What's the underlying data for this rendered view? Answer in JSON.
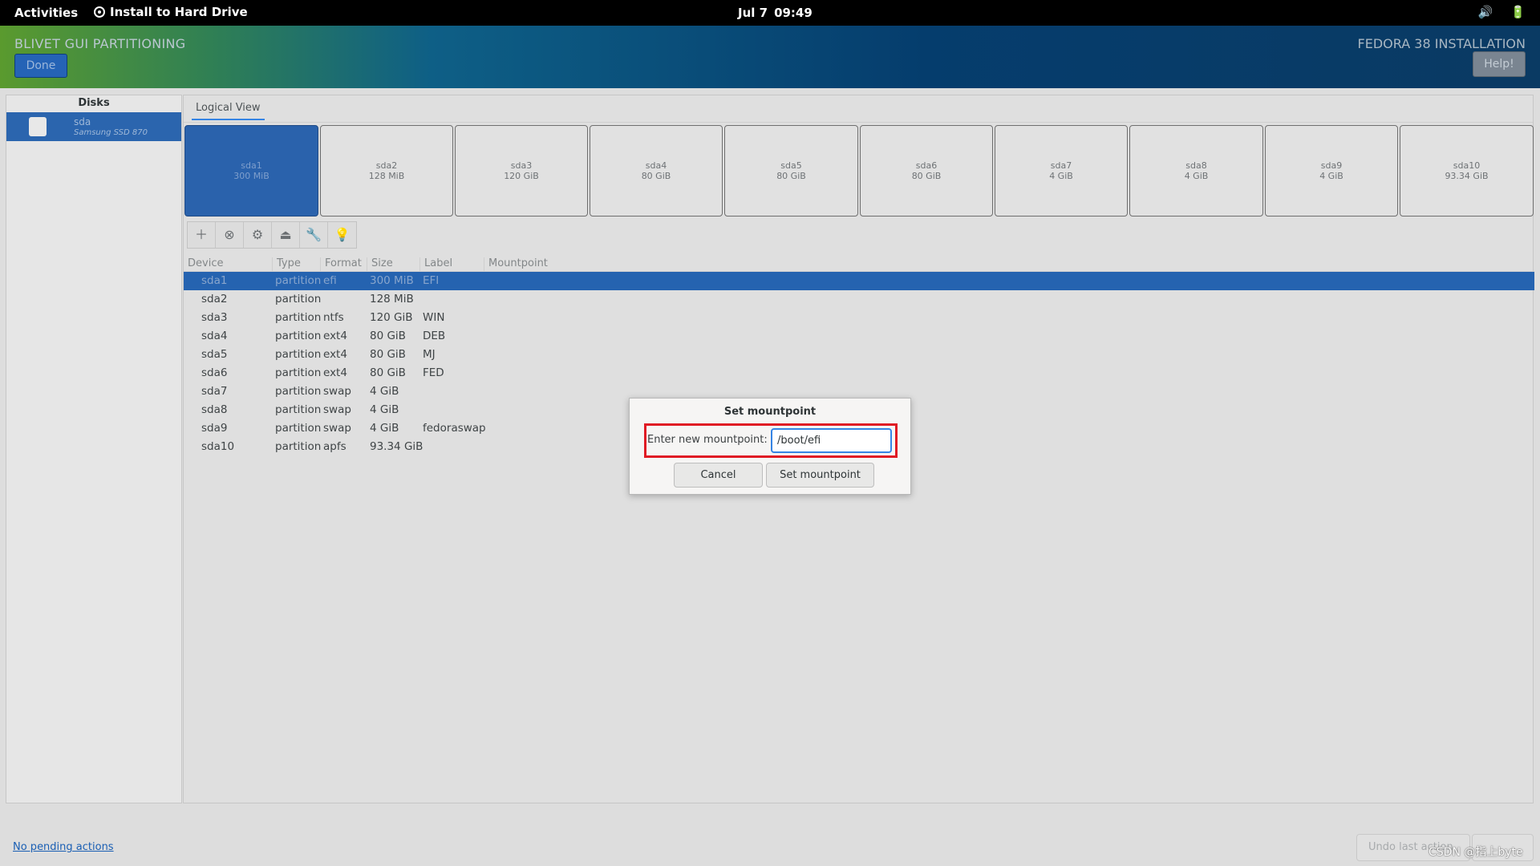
{
  "topbar": {
    "activities": "Activities",
    "app_name": "Install to Hard Drive",
    "date": "Jul 7",
    "time": "09:49",
    "icons": [
      "volume-icon",
      "battery-icon"
    ]
  },
  "header": {
    "spoke_title": "BLIVET GUI PARTITIONING",
    "done_label": "Done",
    "product_title": "FEDORA 38 INSTALLATION",
    "help_label": "Help!"
  },
  "disks": {
    "heading": "Disks",
    "items": [
      {
        "name": "sda",
        "model": "Samsung SSD 870"
      }
    ]
  },
  "logical_view": {
    "tab_label": "Logical View",
    "partitions": [
      {
        "name": "sda1",
        "size": "300 MiB",
        "selected": true
      },
      {
        "name": "sda2",
        "size": "128 MiB",
        "selected": false
      },
      {
        "name": "sda3",
        "size": "120 GiB",
        "selected": false
      },
      {
        "name": "sda4",
        "size": "80 GiB",
        "selected": false
      },
      {
        "name": "sda5",
        "size": "80 GiB",
        "selected": false
      },
      {
        "name": "sda6",
        "size": "80 GiB",
        "selected": false
      },
      {
        "name": "sda7",
        "size": "4 GiB",
        "selected": false
      },
      {
        "name": "sda8",
        "size": "4 GiB",
        "selected": false
      },
      {
        "name": "sda9",
        "size": "4 GiB",
        "selected": false
      },
      {
        "name": "sda10",
        "size": "93.34 GiB",
        "selected": false
      }
    ]
  },
  "toolbar": {
    "icons": [
      "add-icon",
      "delete-icon",
      "edit-icon",
      "unmount-icon",
      "settings-icon",
      "info-icon"
    ]
  },
  "table": {
    "columns": [
      "Device",
      "Type",
      "Format",
      "Size",
      "Label",
      "Mountpoint"
    ],
    "rows": [
      {
        "device": "sda1",
        "type": "partition",
        "format": "efi",
        "size": "300 MiB",
        "label": "EFI",
        "mountpoint": "",
        "selected": true
      },
      {
        "device": "sda2",
        "type": "partition",
        "format": "",
        "size": "128 MiB",
        "label": "",
        "mountpoint": "",
        "selected": false
      },
      {
        "device": "sda3",
        "type": "partition",
        "format": "ntfs",
        "size": "120 GiB",
        "label": "WIN",
        "mountpoint": "",
        "selected": false
      },
      {
        "device": "sda4",
        "type": "partition",
        "format": "ext4",
        "size": "80 GiB",
        "label": "DEB",
        "mountpoint": "",
        "selected": false
      },
      {
        "device": "sda5",
        "type": "partition",
        "format": "ext4",
        "size": "80 GiB",
        "label": "MJ",
        "mountpoint": "",
        "selected": false
      },
      {
        "device": "sda6",
        "type": "partition",
        "format": "ext4",
        "size": "80 GiB",
        "label": "FED",
        "mountpoint": "",
        "selected": false
      },
      {
        "device": "sda7",
        "type": "partition",
        "format": "swap",
        "size": "4 GiB",
        "label": "",
        "mountpoint": "",
        "selected": false
      },
      {
        "device": "sda8",
        "type": "partition",
        "format": "swap",
        "size": "4 GiB",
        "label": "",
        "mountpoint": "",
        "selected": false
      },
      {
        "device": "sda9",
        "type": "partition",
        "format": "swap",
        "size": "4 GiB",
        "label": "fedoraswap",
        "mountpoint": "",
        "selected": false
      },
      {
        "device": "sda10",
        "type": "partition",
        "format": "apfs",
        "size": "93.34 GiB",
        "label": "",
        "mountpoint": "",
        "selected": false
      }
    ]
  },
  "dialog": {
    "title": "Set mountpoint",
    "prompt": "Enter new mountpoint:",
    "input_value": "/boot/efi",
    "cancel_label": "Cancel",
    "confirm_label": "Set mountpoint"
  },
  "footer": {
    "pending_actions": "No pending actions",
    "undo_label": "Undo last action"
  },
  "watermark": "CSDN @指上byte",
  "colors": {
    "selection": "#2563b0",
    "highlight_box": "#e01b24",
    "focus": "#3584e4"
  }
}
